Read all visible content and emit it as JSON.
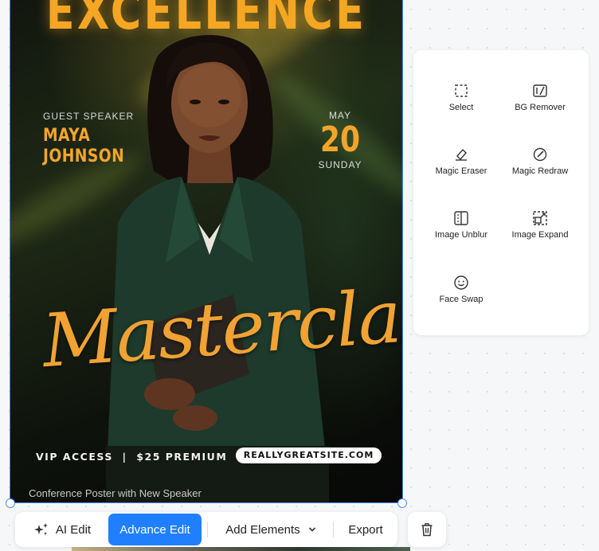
{
  "poster": {
    "headline": "EXCELLENCE",
    "speaker_label": "GUEST SPEAKER",
    "speaker_first": "MAYA",
    "speaker_last": "JOHNSON",
    "date_month": "MAY",
    "date_day": "20",
    "date_weekday": "SUNDAY",
    "script_title": "Masterclass",
    "vip_text": "VIP ACCESS  |  $25 PREMIUM",
    "website": "REALLYGREATSITE.COM",
    "caption": "Conference Poster with New Speaker"
  },
  "tools": {
    "items": [
      {
        "label": "Select",
        "icon": "select-icon"
      },
      {
        "label": "BG Remover",
        "icon": "bg-remover-icon"
      },
      {
        "label": "Magic Eraser",
        "icon": "eraser-icon"
      },
      {
        "label": "Magic Redraw",
        "icon": "redraw-icon"
      },
      {
        "label": "Image Unblur",
        "icon": "unblur-icon"
      },
      {
        "label": "Image Expand",
        "icon": "expand-icon"
      },
      {
        "label": "Face Swap",
        "icon": "face-icon"
      }
    ]
  },
  "toolbar": {
    "ai_edit": "AI Edit",
    "advance_edit": "Advance Edit",
    "add_elements": "Add Elements",
    "export": "Export"
  },
  "colors": {
    "accent": "#1f7fff",
    "poster_gold": "#f3a52a",
    "selection": "#4a8bf0"
  }
}
